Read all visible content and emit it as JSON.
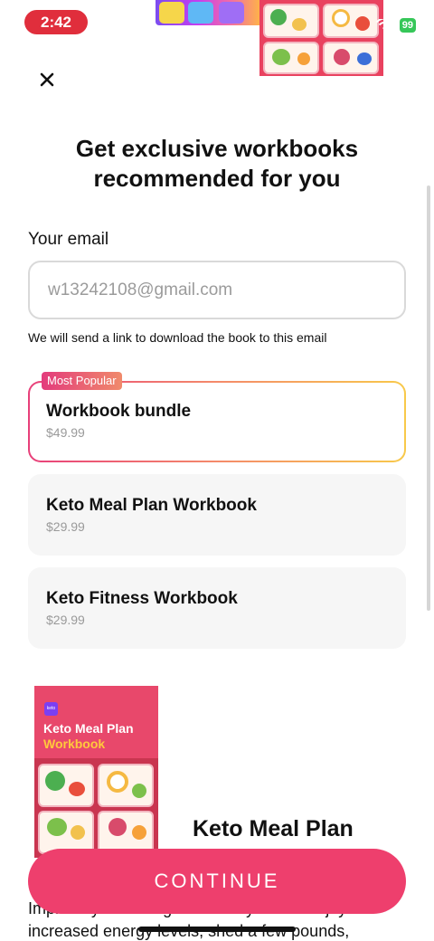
{
  "status_bar": {
    "time": "2:42",
    "battery": "99"
  },
  "header": {
    "close_icon": "close-icon",
    "headline_line1": "Get exclusive workbooks",
    "headline_line2": "recommended for you"
  },
  "email": {
    "label": "Your email",
    "value": "w13242108@gmail.com",
    "note": "We will send a link to download the book to this email"
  },
  "options": [
    {
      "badge": "Most Popular",
      "title": "Workbook bundle",
      "price": "$49.99",
      "selected": true
    },
    {
      "title": "Keto Meal Plan Workbook",
      "price": "$29.99",
      "selected": false
    },
    {
      "title": "Keto Fitness Workbook",
      "price": "$29.99",
      "selected": false
    }
  ],
  "book": {
    "logo": "keto",
    "title_line1": "Keto Meal Plan",
    "title_line2": "Workbook"
  },
  "product": {
    "title": "Keto Meal Plan",
    "description": "Improve your eating habits so you can enjoy increased energy levels, shed a few pounds,"
  },
  "cta": {
    "label": "CONTINUE"
  },
  "colors": {
    "accent": "#ee3f6d",
    "status_time_bg": "#e02e3c",
    "battery_bg": "#36c759"
  }
}
